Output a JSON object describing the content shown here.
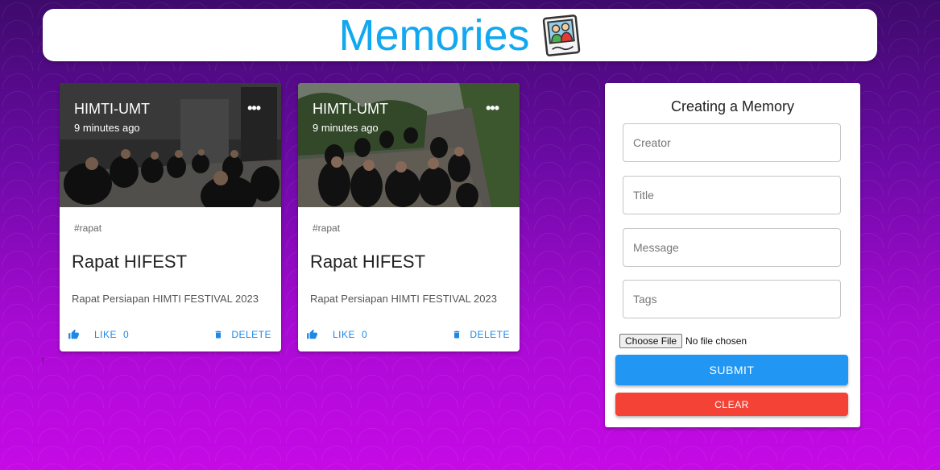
{
  "app": {
    "title": "Memories",
    "logo_icon": "photo-memories-icon"
  },
  "posts": [
    {
      "creator": "HIMTI-UMT",
      "time": "9 minutes ago",
      "tags": "#rapat",
      "title": "Rapat HIFEST",
      "message": "Rapat Persiapan HIMTI FESTIVAL 2023",
      "like_label": "LIKE",
      "like_count": "0",
      "delete_label": "DELETE",
      "more_icon": "more-horizontal-icon",
      "image": "photo-indoor-meeting"
    },
    {
      "creator": "HIMTI-UMT",
      "time": "9 minutes ago",
      "tags": "#rapat",
      "title": "Rapat HIFEST",
      "message": "Rapat Persiapan HIMTI FESTIVAL 2023",
      "like_label": "LIKE",
      "like_count": "0",
      "delete_label": "DELETE",
      "more_icon": "more-horizontal-icon",
      "image": "photo-outdoor-meeting"
    }
  ],
  "form": {
    "title": "Creating a Memory",
    "creator_placeholder": "Creator",
    "title_placeholder": "Title",
    "message_placeholder": "Message",
    "tags_placeholder": "Tags",
    "file_button": "Choose File",
    "file_status": "No file chosen",
    "submit_label": "SUBMIT",
    "clear_label": "CLEAR"
  },
  "colors": {
    "heading": "#12a8f0",
    "primary": "#2196f3",
    "danger": "#f44336",
    "link": "#1e88e5",
    "bg_top": "#3e0a6c",
    "bg_bottom": "#c60ae6"
  }
}
